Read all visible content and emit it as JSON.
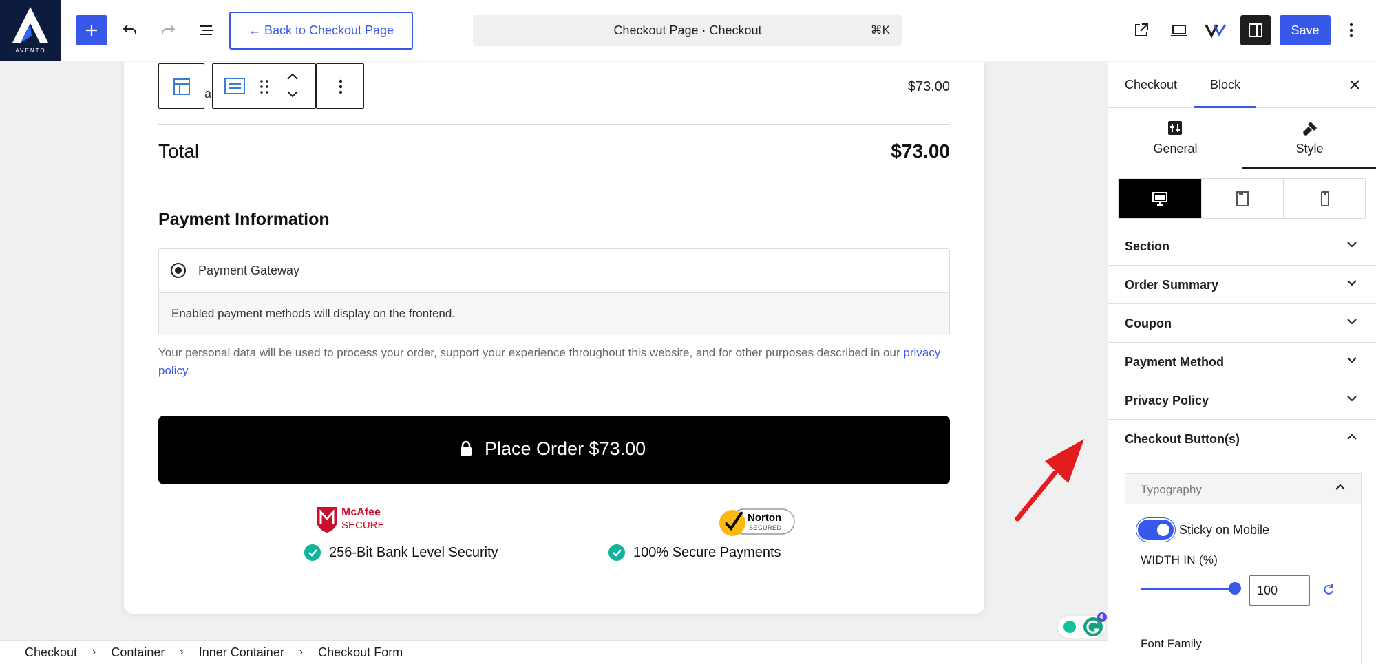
{
  "app": {
    "logo_text": "AVENTO",
    "back_button_label": "← Back to Checkout Page",
    "command_bar_title": "Checkout Page · Checkout",
    "command_bar_shortcut": "⌘K",
    "save_label": "Save",
    "icons": [
      "add-icon",
      "undo-icon",
      "redo-icon",
      "list-view-icon",
      "external-link-icon",
      "laptop-icon",
      "v-logo-icon",
      "sidebar-toggle-icon",
      "more-vertical-icon"
    ]
  },
  "checkout": {
    "block_toolbar_letter": "a",
    "line_item_price": "$73.00",
    "total_label": "Total",
    "total_value": "$73.00",
    "payment_heading": "Payment Information",
    "gateway_label": "Payment Gateway",
    "gateway_note": "Enabled payment methods will display on the frontend.",
    "privacy_text": "Your personal data will be used to process your order, support your experience throughout this website, and for other purposes described in our",
    "privacy_link": "privacy policy",
    "privacy_end": ".",
    "place_order_label": "Place Order  $73.00",
    "badges": {
      "mcafee_brand": "McAfee",
      "mcafee_sub": "SECURE",
      "norton_brand": "Norton",
      "norton_sub": "SECURED"
    },
    "trust_1": "256-Bit Bank Level Security",
    "trust_2": "100% Secure Payments",
    "accent_color": "#3858e9",
    "check_color": "#10b39b"
  },
  "breadcrumb": [
    "Checkout",
    "Container",
    "Inner Container",
    "Checkout Form"
  ],
  "sidebar": {
    "tabs": [
      "Checkout",
      "Block"
    ],
    "active_tab": "Block",
    "mode_tabs": [
      "General",
      "Style"
    ],
    "active_mode": "Style",
    "devices": [
      "desktop",
      "tablet",
      "mobile"
    ],
    "active_device": "desktop",
    "panels": [
      "Section",
      "Order Summary",
      "Coupon",
      "Payment Method",
      "Privacy Policy",
      "Checkout Button(s)"
    ],
    "typography": {
      "title": "Typography",
      "sticky_label": "Sticky on Mobile",
      "sticky_on": true,
      "width_label": "WIDTH IN (%)",
      "width_value": "100",
      "font_family_label": "Font Family"
    },
    "grammarly_count": "4"
  }
}
